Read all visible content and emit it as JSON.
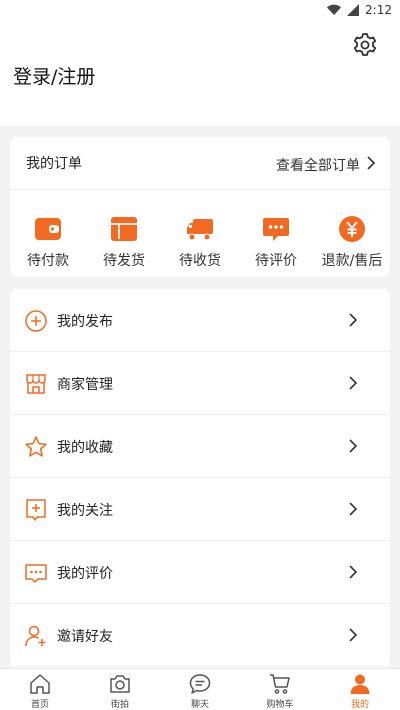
{
  "status": {
    "time": "2:12"
  },
  "header": {
    "login_label": "登录/注册"
  },
  "orders": {
    "title": "我的订单",
    "view_all": "查看全部订单",
    "items": [
      {
        "label": "待付款",
        "icon": "wallet-icon"
      },
      {
        "label": "待发货",
        "icon": "box-icon"
      },
      {
        "label": "待收货",
        "icon": "truck-icon"
      },
      {
        "label": "待评价",
        "icon": "comment-icon"
      },
      {
        "label": "退款/售后",
        "icon": "yuan-icon"
      }
    ]
  },
  "menu": {
    "items": [
      {
        "label": "我的发布",
        "icon": "plus-circle-icon"
      },
      {
        "label": "商家管理",
        "icon": "store-icon"
      },
      {
        "label": "我的收藏",
        "icon": "star-icon"
      },
      {
        "label": "我的关注",
        "icon": "bookmark-plus-icon"
      },
      {
        "label": "我的评价",
        "icon": "comment-outline-icon"
      },
      {
        "label": "邀请好友",
        "icon": "user-plus-icon"
      }
    ]
  },
  "tabbar": {
    "items": [
      {
        "label": "首页",
        "icon": "home-icon",
        "active": false
      },
      {
        "label": "街拍",
        "icon": "camera-icon",
        "active": false
      },
      {
        "label": "聊天",
        "icon": "chat-icon",
        "active": false
      },
      {
        "label": "购物车",
        "icon": "cart-icon",
        "active": false
      },
      {
        "label": "我的",
        "icon": "person-icon",
        "active": true
      }
    ]
  },
  "colors": {
    "accent": "#f26a21",
    "background": "#f2f2f2"
  }
}
